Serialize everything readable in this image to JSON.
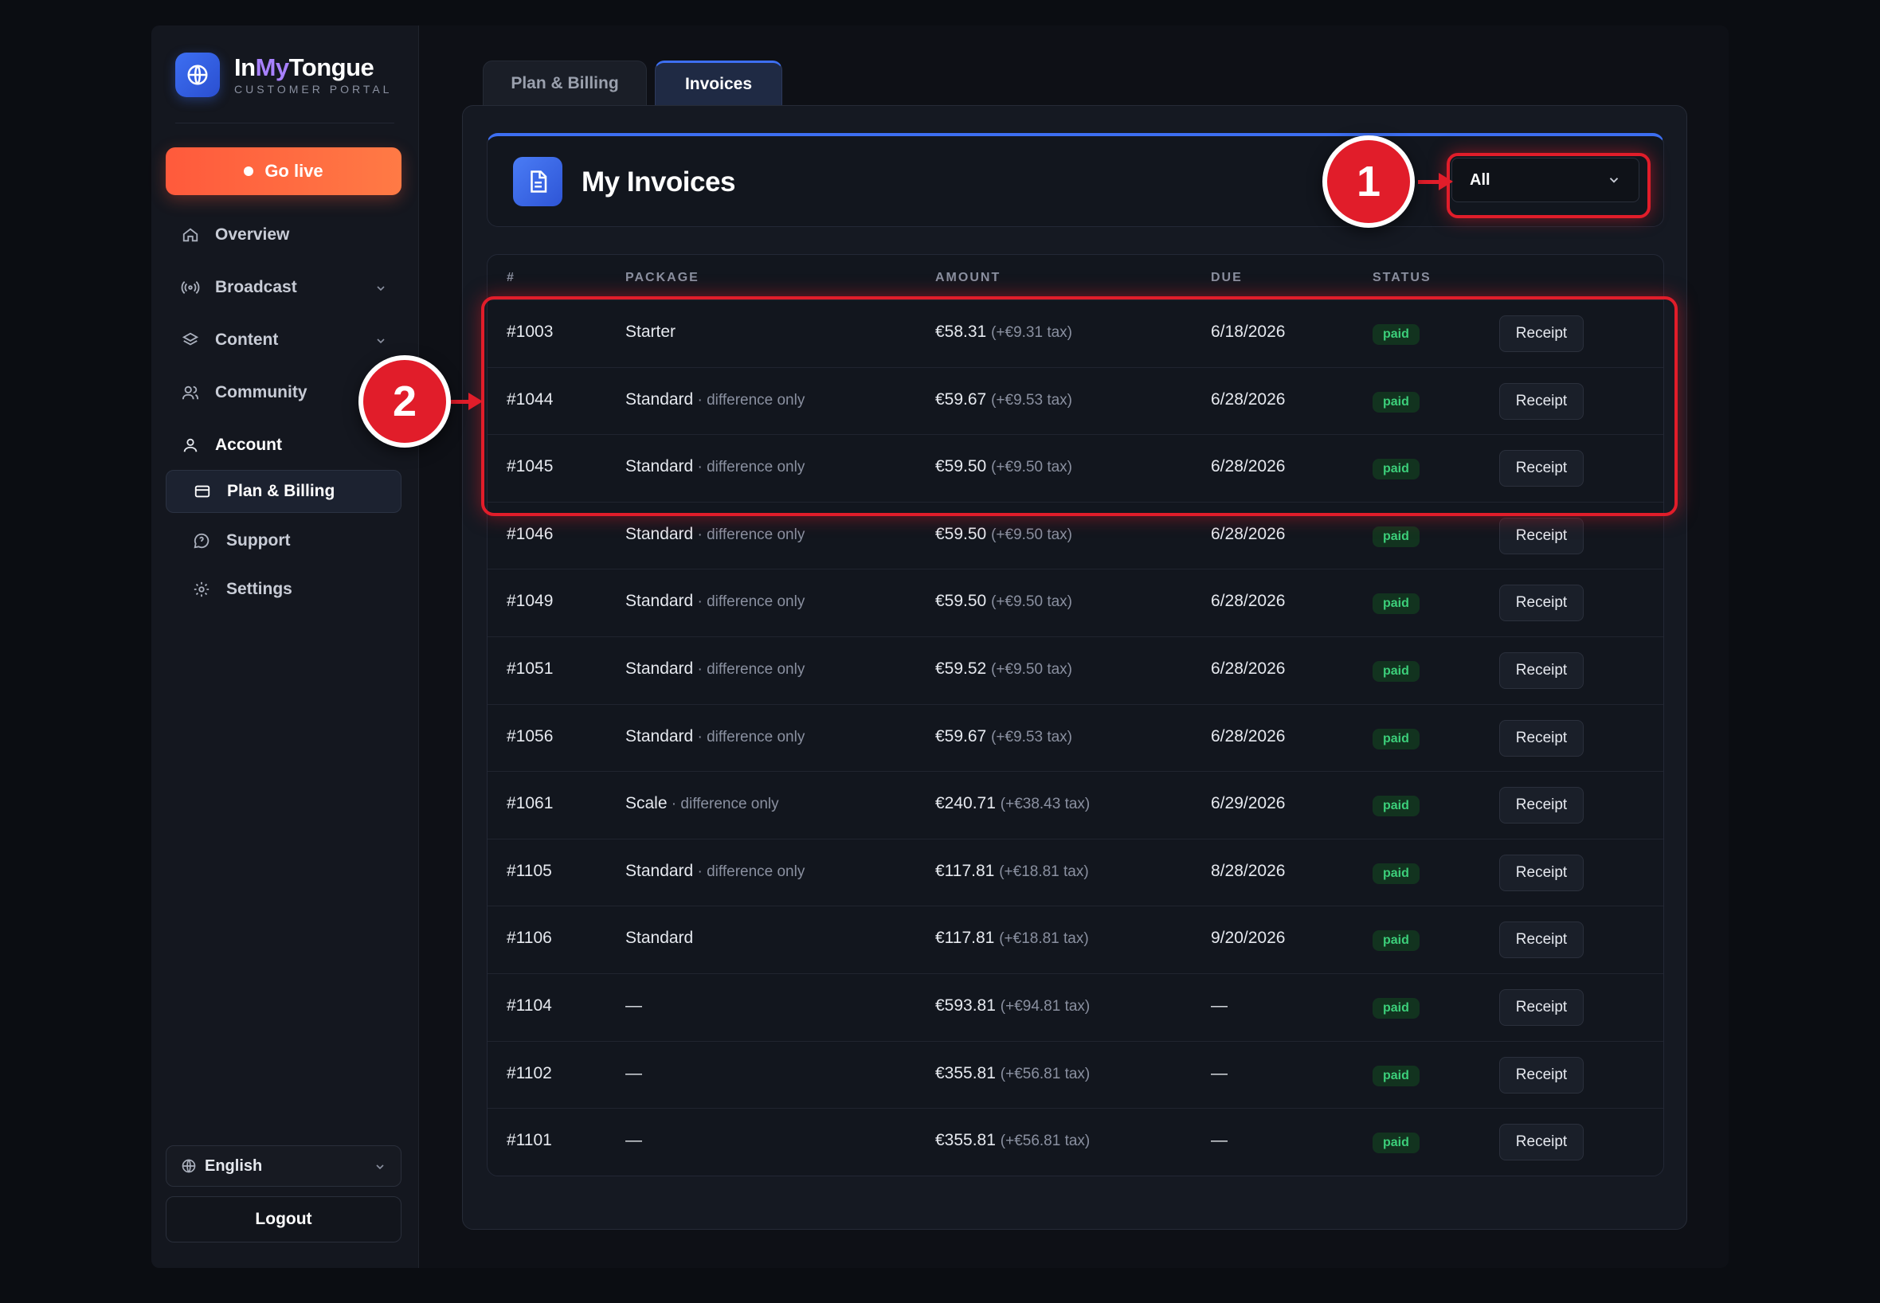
{
  "brand": {
    "name_part1": "In",
    "name_part2": "My",
    "name_part3": "Tongue",
    "subtitle": "CUSTOMER PORTAL"
  },
  "sidebar": {
    "go_live": "Go live",
    "items": [
      {
        "label": "Overview",
        "icon": "home-icon"
      },
      {
        "label": "Broadcast",
        "icon": "broadcast-icon"
      },
      {
        "label": "Content",
        "icon": "layers-icon"
      },
      {
        "label": "Community",
        "icon": "users-icon"
      },
      {
        "label": "Account",
        "icon": "user-icon"
      },
      {
        "label": "Plan & Billing",
        "icon": "credit-card-icon"
      },
      {
        "label": "Support",
        "icon": "chat-icon"
      },
      {
        "label": "Settings",
        "icon": "gear-icon"
      }
    ],
    "language": "English",
    "logout": "Logout"
  },
  "tabs": [
    {
      "label": "Plan & Billing"
    },
    {
      "label": "Invoices"
    }
  ],
  "invoices": {
    "title": "My Invoices",
    "filter_value": "All",
    "columns": [
      "#",
      "PACKAGE",
      "AMOUNT",
      "DUE",
      "STATUS"
    ],
    "rows": [
      {
        "id": "#1003",
        "package": "Starter",
        "note": "",
        "amount": "€58.31",
        "tax": "(+€9.31 tax)",
        "due": "6/18/2026",
        "status": "paid",
        "action": "Receipt"
      },
      {
        "id": "#1044",
        "package": "Standard",
        "note": " · difference only",
        "amount": "€59.67",
        "tax": "(+€9.53 tax)",
        "due": "6/28/2026",
        "status": "paid",
        "action": "Receipt"
      },
      {
        "id": "#1045",
        "package": "Standard",
        "note": " · difference only",
        "amount": "€59.50",
        "tax": "(+€9.50 tax)",
        "due": "6/28/2026",
        "status": "paid",
        "action": "Receipt"
      },
      {
        "id": "#1046",
        "package": "Standard",
        "note": " · difference only",
        "amount": "€59.50",
        "tax": "(+€9.50 tax)",
        "due": "6/28/2026",
        "status": "paid",
        "action": "Receipt"
      },
      {
        "id": "#1049",
        "package": "Standard",
        "note": " · difference only",
        "amount": "€59.50",
        "tax": "(+€9.50 tax)",
        "due": "6/28/2026",
        "status": "paid",
        "action": "Receipt"
      },
      {
        "id": "#1051",
        "package": "Standard",
        "note": " · difference only",
        "amount": "€59.52",
        "tax": "(+€9.50 tax)",
        "due": "6/28/2026",
        "status": "paid",
        "action": "Receipt"
      },
      {
        "id": "#1056",
        "package": "Standard",
        "note": " · difference only",
        "amount": "€59.67",
        "tax": "(+€9.53 tax)",
        "due": "6/28/2026",
        "status": "paid",
        "action": "Receipt"
      },
      {
        "id": "#1061",
        "package": "Scale",
        "note": " · difference only",
        "amount": "€240.71",
        "tax": "(+€38.43 tax)",
        "due": "6/29/2026",
        "status": "paid",
        "action": "Receipt"
      },
      {
        "id": "#1105",
        "package": "Standard",
        "note": " · difference only",
        "amount": "€117.81",
        "tax": "(+€18.81 tax)",
        "due": "8/28/2026",
        "status": "paid",
        "action": "Receipt"
      },
      {
        "id": "#1106",
        "package": "Standard",
        "note": "",
        "amount": "€117.81",
        "tax": "(+€18.81 tax)",
        "due": "9/20/2026",
        "status": "paid",
        "action": "Receipt"
      },
      {
        "id": "#1104",
        "package": "—",
        "note": "",
        "amount": "€593.81",
        "tax": "(+€94.81 tax)",
        "due": "—",
        "status": "paid",
        "action": "Receipt"
      },
      {
        "id": "#1102",
        "package": "—",
        "note": "",
        "amount": "€355.81",
        "tax": "(+€56.81 tax)",
        "due": "—",
        "status": "paid",
        "action": "Receipt"
      },
      {
        "id": "#1101",
        "package": "—",
        "note": "",
        "amount": "€355.81",
        "tax": "(+€56.81 tax)",
        "due": "—",
        "status": "paid",
        "action": "Receipt"
      }
    ]
  },
  "annotations": {
    "marker_1": "1",
    "marker_2": "2"
  },
  "colors": {
    "accent": "#3d6ff2",
    "live": "#ff5a3c",
    "paid": "#3ccf7a",
    "annotation": "#e11d2a"
  }
}
